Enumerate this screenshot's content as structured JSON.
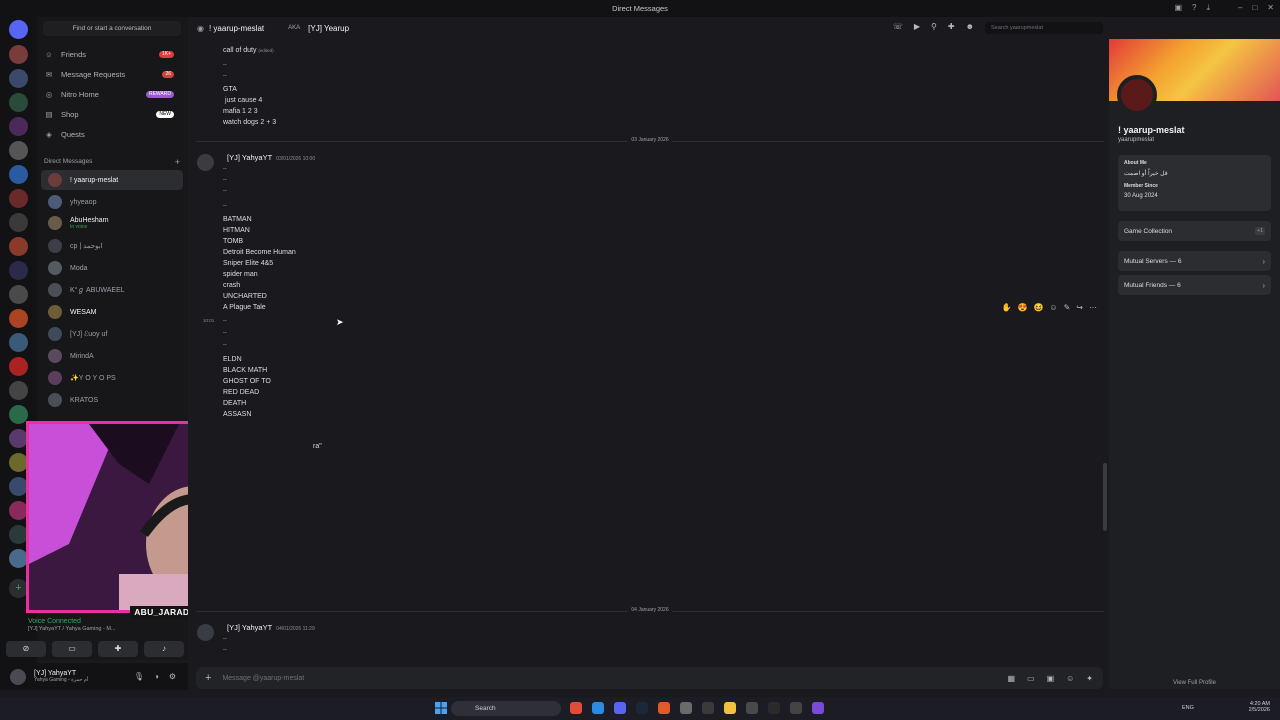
{
  "window": {
    "title": "Direct Messages"
  },
  "dm_sidebar": {
    "find_label": "Find or start a conversation",
    "nav": [
      {
        "label": "Friends",
        "badge": "1K+",
        "icon": "friends-icon"
      },
      {
        "label": "Message Requests",
        "badge": "26",
        "icon": "mail-icon"
      },
      {
        "label": "Nitro Home",
        "badge": "REWARD",
        "icon": "nitro-icon"
      },
      {
        "label": "Shop",
        "badge": "NEW",
        "icon": "shop-icon"
      },
      {
        "label": "Quests",
        "badge": "",
        "icon": "quests-icon"
      }
    ],
    "dm_header": "Direct Messages",
    "dms": [
      {
        "name": "! yaarup-meslat",
        "sub": "",
        "color": "#6b3c3c"
      },
      {
        "name": "yhyeaop",
        "sub": "",
        "color": "#4d5a78"
      },
      {
        "name": "AbuHesham",
        "sub": "In voice",
        "color": "#6a5a4a"
      },
      {
        "name": "cp | ابوحمد",
        "sub": "",
        "color": "#3c3f47"
      },
      {
        "name": "Moda",
        "sub": "",
        "color": "#555a60"
      },
      {
        "name": "K°ℊ ABUWAEEL",
        "sub": "",
        "color": "#4a4f57"
      },
      {
        "name": "WESAM",
        "sub": "",
        "color": "#6e5b3a"
      },
      {
        "name": "[YJ] ℰuoy uf",
        "sub": "",
        "color": "#3f4a5a"
      },
      {
        "name": "MirindA",
        "sub": "",
        "color": "#5a4a5e"
      },
      {
        "name": "✨Y O Y O PS",
        "sub": "",
        "color": "#5c3e5c"
      },
      {
        "name": "KRATOS",
        "sub": "",
        "color": "#4a4f57"
      }
    ]
  },
  "webcam": {
    "label": "ABU_JARADEH"
  },
  "voice": {
    "status": "Voice Connected",
    "channel": "[YJ] YahyaYT / Yahya Gaming - M..."
  },
  "user_panel": {
    "name": "[YJ] YahyaYT",
    "status": "Yahya Gaming - أم حمزة"
  },
  "chat": {
    "header_name": "! yaarup-meslat",
    "aka_label": "AKA",
    "aka_name": "[YJ] Yearup",
    "lines_top": [
      "call of duty",
      "..",
      "..",
      "GTA",
      " just cause 4",
      "mafia 1 2 3",
      "watch dogs 2 + 3"
    ],
    "edited_label": "(edited)",
    "divider1": "03 January 2026",
    "author1": "[YJ] YahyaYT",
    "author1_ts": "03/01/2026 10:00",
    "lines_mid": [
      "..",
      "..",
      "..",
      "..",
      "BATMAN",
      "HITMAN",
      "TOMB",
      "Detroit Become Human",
      "Sniper Elite 4&5",
      "spider man",
      "crash",
      "UNCHARTED",
      "A Plague Tale"
    ],
    "hover_time": "10:01",
    "lines_low": [
      "..",
      "..",
      "..",
      "ELDN",
      "BLACK MATH",
      "GHOST OF TO",
      "RED DEAD",
      "DEATH",
      "ASSASN"
    ],
    "partial_text": "ra\"",
    "divider2": "04 January 2026",
    "author2": "[YJ] YahyaYT",
    "author2_ts": "04/01/2026 11:29",
    "lines_end": [
      "..",
      ".."
    ],
    "composer_placeholder": "Message @yaarup-meslat",
    "search_placeholder": "Search yaarupmeslat"
  },
  "profile": {
    "display_name": "! yaarup-meslat",
    "username": "yaarupmeslat",
    "about_label": "About Me",
    "about_text": "قل خيراً أو اصمت",
    "member_since_label": "Member Since",
    "member_since": "30 Aug 2024",
    "game_collection": "Game Collection",
    "game_more": "+1",
    "mutual_servers": "Mutual Servers — 6",
    "mutual_friends": "Mutual Friends — 6",
    "view_full": "View Full Profile"
  },
  "taskbar": {
    "search": "Search",
    "lang": "ENG",
    "time": "4:20 AM",
    "date": "2/5/2026"
  }
}
